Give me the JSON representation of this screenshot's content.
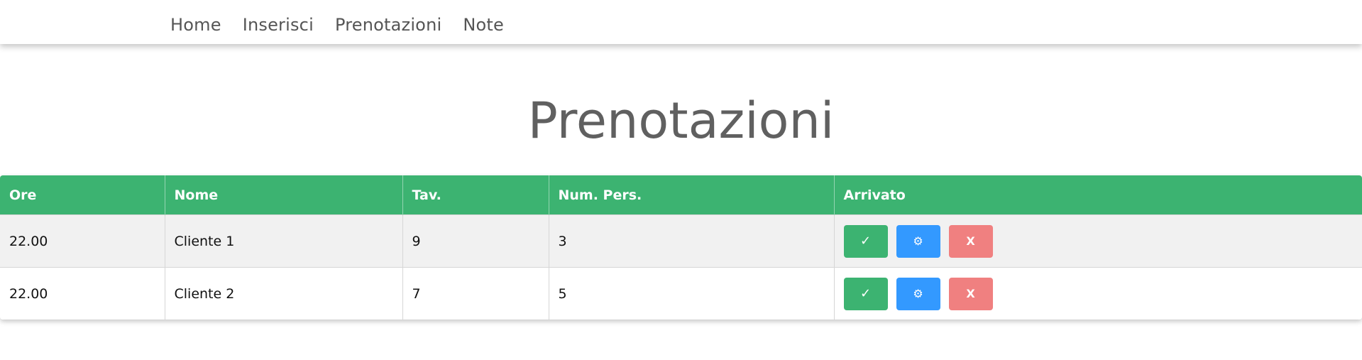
{
  "nav": {
    "items": [
      {
        "label": "Home"
      },
      {
        "label": "Inserisci"
      },
      {
        "label": "Prenotazioni"
      },
      {
        "label": "Note"
      }
    ]
  },
  "page": {
    "title": "Prenotazioni"
  },
  "table": {
    "headers": [
      "Ore",
      "Nome",
      "Tav.",
      "Num. Pers.",
      "Arrivato"
    ],
    "rows": [
      {
        "ore": "22.00",
        "nome": "Cliente 1",
        "tavolo": "9",
        "persone": "3"
      },
      {
        "ore": "22.00",
        "nome": "Cliente 2",
        "tavolo": "7",
        "persone": "5"
      }
    ],
    "actions": {
      "confirm_icon": "✓",
      "edit_icon": "⚙",
      "delete_icon": "X"
    }
  },
  "colors": {
    "green": "#3cb371",
    "blue": "#3399ff",
    "red": "#f08080"
  }
}
